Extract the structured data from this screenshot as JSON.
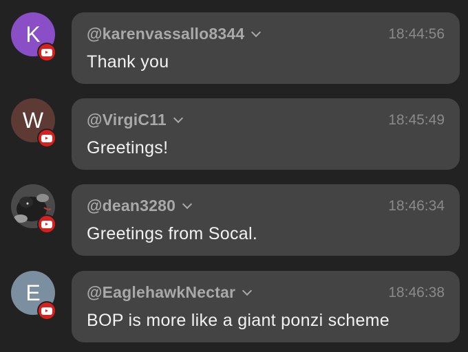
{
  "messages": [
    {
      "avatar_letter": "K",
      "avatar_color": "#8a4fc7",
      "platform_icon": "youtube-icon",
      "username": "@karenvassallo8344",
      "time": "18:44:56",
      "text": "Thank you"
    },
    {
      "avatar_letter": "W",
      "avatar_color": "#5d3a33",
      "platform_icon": "youtube-icon",
      "username": "@VirgiC11",
      "time": "18:45:49",
      "text": "Greetings!"
    },
    {
      "avatar_letter": "",
      "avatar_color": "#333333",
      "platform_icon": "youtube-icon",
      "username": "@dean3280",
      "time": "18:46:34",
      "text": "Greetings from Socal."
    },
    {
      "avatar_letter": "E",
      "avatar_color": "#7b8fa1",
      "platform_icon": "youtube-icon",
      "username": "@EaglehawkNectar",
      "time": "18:46:38",
      "text": "BOP is more like a giant ponzi scheme"
    }
  ]
}
